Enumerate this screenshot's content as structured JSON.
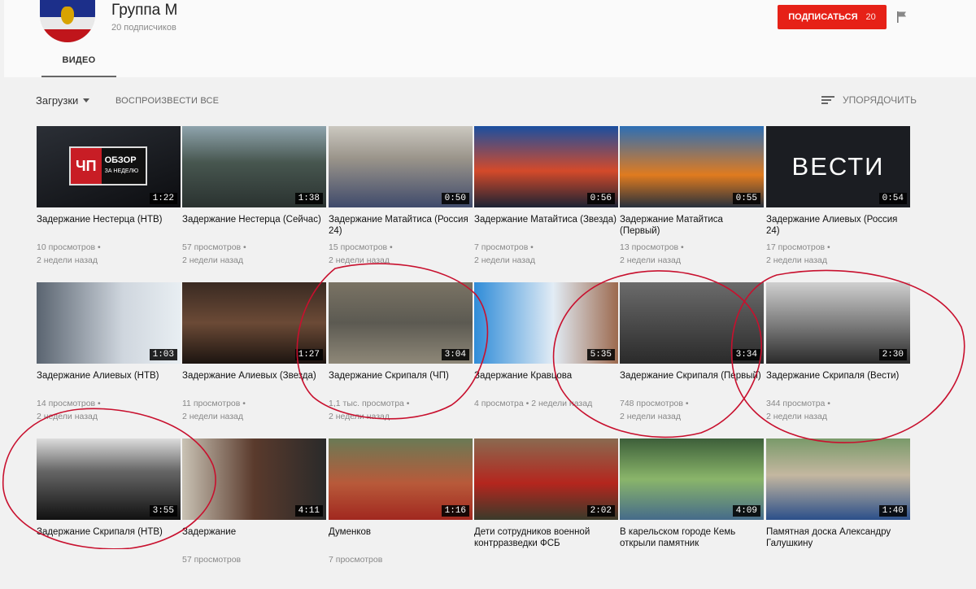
{
  "channel": {
    "name": "Группа М",
    "subscribers": "20 подписчиков",
    "subscribe_label": "ПОДПИСАТЬСЯ",
    "subscribe_count": "20",
    "tab_video": "ВИДЕО"
  },
  "toolbar": {
    "dropdown_label": "Загрузки",
    "play_all": "ВОСПРОИЗВЕСТИ ВСЕ",
    "sort_label": "УПОРЯДОЧИТЬ"
  },
  "videos": [
    {
      "title": "Задержание Нестерца (НТВ)",
      "duration": "1:22",
      "views": "10 просмотров •",
      "date": "2 недели назад"
    },
    {
      "title": "Задержание Нестерца (Сейчас)",
      "duration": "1:38",
      "views": "57 просмотров •",
      "date": "2 недели назад"
    },
    {
      "title": "Задержание Матайтиса (Россия 24)",
      "duration": "0:50",
      "views": "15 просмотров •",
      "date": "2 недели назад"
    },
    {
      "title": "Задержание Матайтиса (Звезда)",
      "duration": "0:56",
      "views": "7 просмотров •",
      "date": "2 недели назад"
    },
    {
      "title": "Задержание Матайтиса (Первый)",
      "duration": "0:55",
      "views": "13 просмотров •",
      "date": "2 недели назад"
    },
    {
      "title": "Задержание Алиевых (Россия 24)",
      "duration": "0:54",
      "views": "17 просмотров •",
      "date": "2 недели назад"
    },
    {
      "title": "Задержание Алиевых (НТВ)",
      "duration": "1:03",
      "views": "14 просмотров •",
      "date": "2 недели назад"
    },
    {
      "title": "Задержание Алиевых (Звезда)",
      "duration": "1:27",
      "views": "11 просмотров •",
      "date": "2 недели назад"
    },
    {
      "title": "Задержание Скрипаля (ЧП)",
      "duration": "3:04",
      "views": "1,1 тыс. просмотра •",
      "date": "2 недели назад"
    },
    {
      "title": "Задержание Кравцова",
      "duration": "5:35",
      "views": "4 просмотра • 2 недели назад",
      "date": ""
    },
    {
      "title": "Задержание Скрипаля (Первый)",
      "duration": "3:34",
      "views": "748 просмотров •",
      "date": "2 недели назад"
    },
    {
      "title": "Задержание Скрипаля (Вести)",
      "duration": "2:30",
      "views": "344 просмотра •",
      "date": "2 недели назад"
    },
    {
      "title": "Задержание Скрипаля (НТВ)",
      "duration": "3:55",
      "views": "",
      "date": ""
    },
    {
      "title": "Задержание",
      "duration": "4:11",
      "views": "57 просмотров",
      "date": ""
    },
    {
      "title": "Думенков",
      "duration": "1:16",
      "views": "7 просмотров",
      "date": ""
    },
    {
      "title": "Дети сотрудников военной контрразведки ФСБ",
      "duration": "2:02",
      "views": "",
      "date": ""
    },
    {
      "title": "В карельском городе Кемь открыли памятник",
      "duration": "4:09",
      "views": "",
      "date": ""
    },
    {
      "title": "Памятная доска Александру Галушкину",
      "duration": "1:40",
      "views": "",
      "date": ""
    }
  ],
  "thumb_text": {
    "chp_red": "ЧП",
    "chp_text": "ОБЗОР",
    "chp_sub": "ЗА НЕДЕЛЮ",
    "vesti": "ВЕСТИ"
  },
  "colors": {
    "subscribe_bg": "#e62117",
    "annotation": "#c8102e"
  },
  "icons": {
    "flag": "flag-icon",
    "sort": "sort-icon",
    "dropdown": "chevron-down-icon"
  }
}
